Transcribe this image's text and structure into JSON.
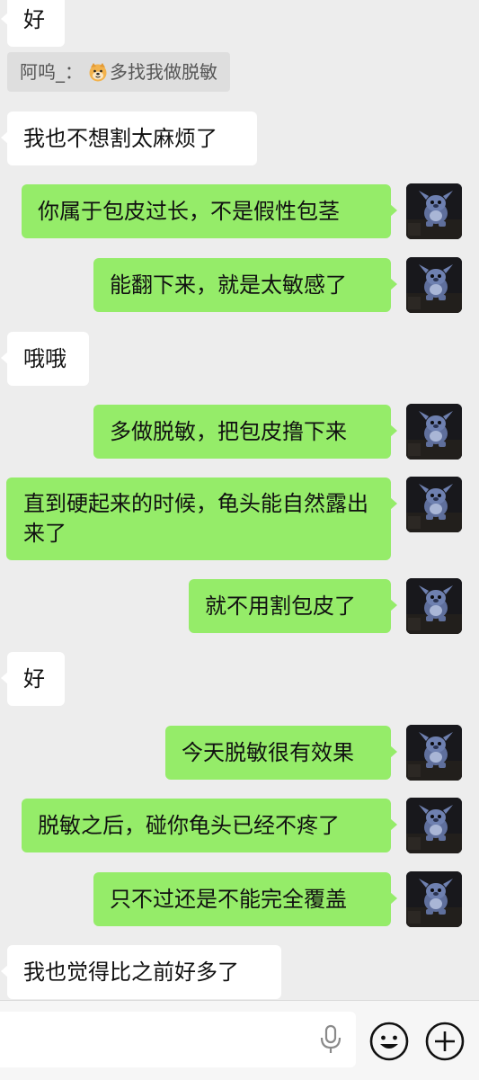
{
  "quote": {
    "author": "阿呜_：",
    "text": "多找我做脱敏",
    "emoji": "doge-emoji"
  },
  "messages": [
    {
      "side": "in",
      "text": "好"
    },
    {
      "side": "in",
      "text": "我也不想割太麻烦了"
    },
    {
      "side": "out",
      "text": "你属于包皮过长，不是假性包茎"
    },
    {
      "side": "out",
      "text": "能翻下来，就是太敏感了"
    },
    {
      "side": "in",
      "text": "哦哦"
    },
    {
      "side": "out",
      "text": "多做脱敏，把包皮撸下来"
    },
    {
      "side": "out",
      "text": "直到硬起来的时候，龟头能自然露出来了"
    },
    {
      "side": "out",
      "text": "就不用割包皮了"
    },
    {
      "side": "in",
      "text": "好"
    },
    {
      "side": "out",
      "text": "今天脱敏很有效果"
    },
    {
      "side": "out",
      "text": "脱敏之后，碰你龟头已经不疼了"
    },
    {
      "side": "out",
      "text": "只不过还是不能完全覆盖"
    },
    {
      "side": "in",
      "text": "我也觉得比之前好多了"
    }
  ],
  "input": {
    "value": "",
    "mic_icon": "microphone-icon",
    "emoji_icon": "smiley-icon",
    "plus_icon": "plus-icon"
  },
  "colors": {
    "background": "#ededed",
    "outgoing_bubble": "#95ec69",
    "incoming_bubble": "#ffffff"
  }
}
